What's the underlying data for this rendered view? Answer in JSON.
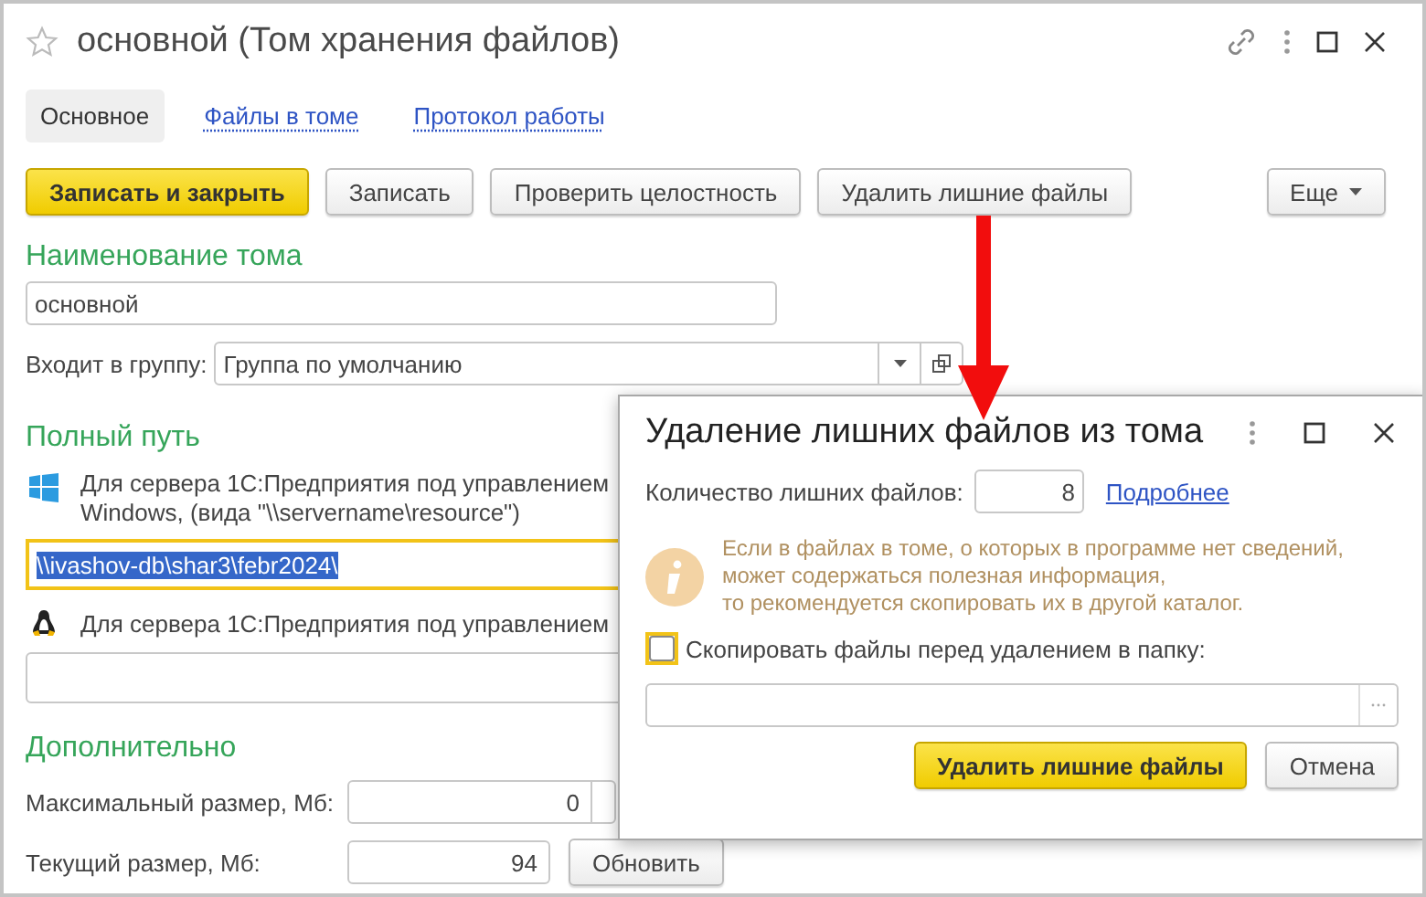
{
  "window": {
    "title": "основной (Том хранения файлов)"
  },
  "tabs": [
    {
      "label": "Основное",
      "selected": true
    },
    {
      "label": "Файлы в томе",
      "selected": false
    },
    {
      "label": "Протокол работы",
      "selected": false
    }
  ],
  "toolbar": {
    "buttons": [
      {
        "label": "Записать и закрыть",
        "kind": "default"
      },
      {
        "label": "Записать",
        "kind": "normal"
      },
      {
        "label": "Проверить целостность",
        "kind": "normal"
      },
      {
        "label": "Удалить лишние файлы",
        "kind": "normal"
      }
    ],
    "more": "Еще"
  },
  "name_section": {
    "heading": "Наименование тома",
    "value": "основной"
  },
  "group": {
    "label": "Входит в группу:",
    "value": "Группа по умолчанию"
  },
  "path_section": {
    "heading": "Полный путь",
    "windows": {
      "hint": "Для сервера 1С:Предприятия под управлением Windows, (вида \"\\\\servername\\resource\")",
      "value": "\\\\ivashov-db\\shar3\\febr2024\\",
      "focused": true,
      "text_selected": true
    },
    "linux": {
      "hint": "Для сервера 1С:Предприятия под управлением"
    }
  },
  "additional": {
    "heading": "Дополнительно",
    "max_size": {
      "label": "Максимальный размер, Мб:",
      "value": "0"
    },
    "current_size": {
      "label": "Текущий размер, Мб:",
      "value": "94"
    },
    "refresh_button": "Обновить"
  },
  "dialog": {
    "title": "Удаление лишних файлов из тома",
    "count_label": "Количество лишних файлов:",
    "count": "8",
    "details_link": "Подробнее",
    "info": [
      "Если в файлах в томе, о которых в программе нет сведений,",
      "может содержаться полезная информация,",
      "то рекомендуется скопировать их в другой каталог."
    ],
    "copy": {
      "label": "Скопировать файлы перед удалением в папку:",
      "checked": false
    },
    "buttons": [
      {
        "label": "Удалить лишние файлы",
        "kind": "default"
      },
      {
        "label": "Отмена",
        "kind": "normal"
      }
    ]
  }
}
